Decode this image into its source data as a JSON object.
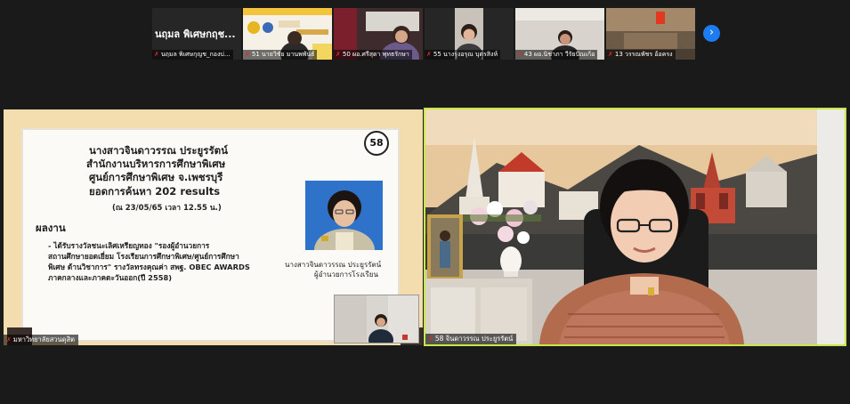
{
  "thumbnails": [
    {
      "label": "นฤมล  พิเศษกุญช_กองบ่...",
      "big_text": "นฤมล  พิเศษกฤช...",
      "muted": true
    },
    {
      "label": "51 นายวิชัย มานพพันธ์",
      "muted": true
    },
    {
      "label": "50 ผอ.ศรีสุดา  พุทธรักษา",
      "muted": true
    },
    {
      "label": "55 นางรุ่งอรุณ บุตรสิงห์",
      "muted": true
    },
    {
      "label": "43 ผอ.นิชาภา วีรัยปัณเก้อ",
      "muted": true
    },
    {
      "label": "13 วรรณพัชร  อ้อครง",
      "muted": true
    }
  ],
  "next_page_icon": "chevron-right-icon",
  "slide": {
    "number": "58",
    "name": "นางสาวจินดาวรรณ ประยูรรัตน์",
    "office": "สำนักงานบริหารการศึกษาพิเศษ",
    "center": "ศูนย์การศึกษาพิเศษ จ.เพชรบุรี",
    "search_count": "ยอดการค้นหา 202  results",
    "as_of": "(ณ 23/05/65  เวลา 12.55 น.)",
    "works_heading": "ผลงาน",
    "works_lines": [
      "- ได้รับรางวัลชนะเลิศเหรียญทอง \"รองผู้อำนวยการ",
      "สถานศึกษายอดเยี่ยม โรงเรียนการศึกษาพิเศษ/ศูนย์การศึกษา",
      "พิเศษ ด้านวิชาการ\" รางวัลทรงคุณค่า สพฐ. OBEC AWARDS",
      "ภาคกลางและภาคตะวันออก(ปี 2558)"
    ],
    "caption_name": "นางสาวจินดาวรรณ      ประยูรรัตน์",
    "caption_role": "ผู้อำนวยการโรงเรียน"
  },
  "left_tile_label": "มหาวิทยาลัยสวนดุสิต",
  "right_tile_label": "58 จินดาวรรณ ประยูรรัตน์",
  "colors": {
    "active_border": "#c8e84a",
    "mic_muted": "#e02828",
    "next_button": "#1e7cf2",
    "slide_frame": "#f3dcae"
  }
}
